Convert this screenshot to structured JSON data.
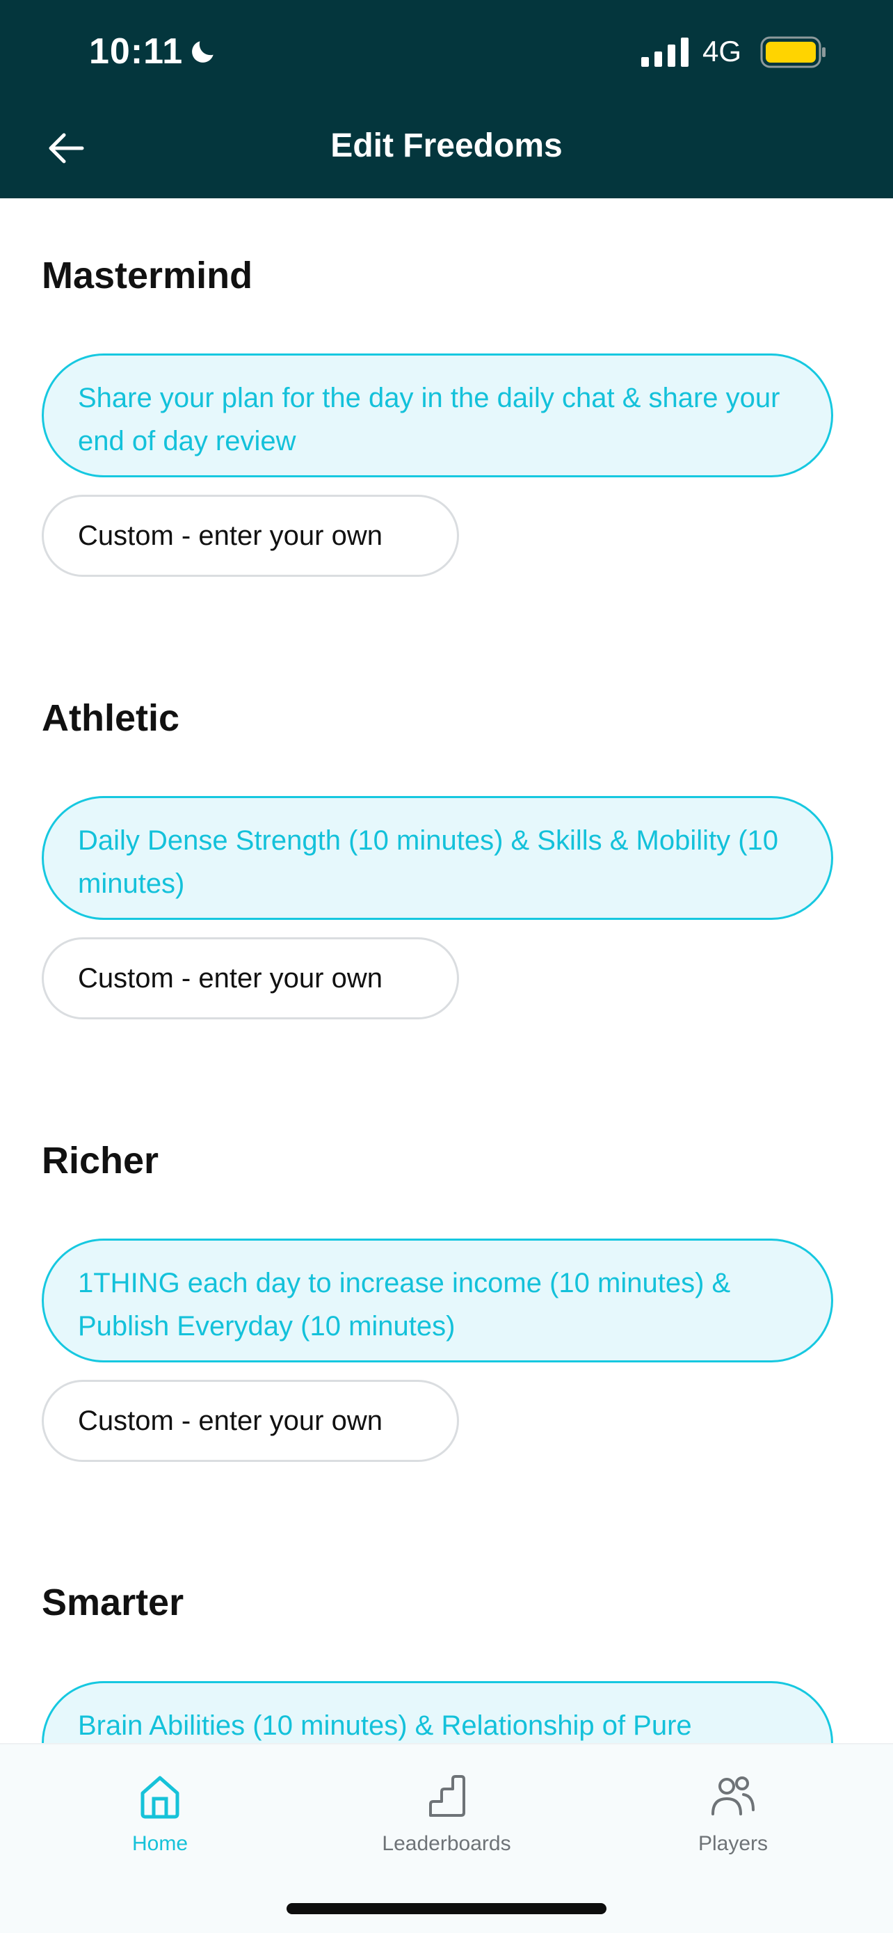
{
  "status_bar": {
    "time": "10:11",
    "network": "4G"
  },
  "header": {
    "title": "Edit Freedoms"
  },
  "sections": [
    {
      "title": "Mastermind",
      "selected": "Share your plan for the day in the daily chat & share your end of day review",
      "custom": "Custom - enter your own"
    },
    {
      "title": "Athletic",
      "selected": "Daily Dense Strength (10 minutes) & Skills & Mobility (10 minutes)",
      "custom": "Custom - enter your own"
    },
    {
      "title": "Richer",
      "selected": "1THING each day to increase income (10 minutes) & Publish Everyday (10 minutes)",
      "custom": "Custom - enter your own"
    },
    {
      "title": "Smarter",
      "selected": "Brain Abilities (10 minutes) & Relationship of Pure"
    }
  ],
  "bottom_nav": [
    {
      "label": "Home",
      "icon": "home-icon",
      "active": true
    },
    {
      "label": "Leaderboards",
      "icon": "stairs-icon",
      "active": false
    },
    {
      "label": "Players",
      "icon": "players-icon",
      "active": false
    }
  ],
  "colors": {
    "header_bg": "#04363D",
    "accent": "#16C8E0",
    "selected_bg": "#E6F8FC",
    "battery": "#FFD400"
  }
}
